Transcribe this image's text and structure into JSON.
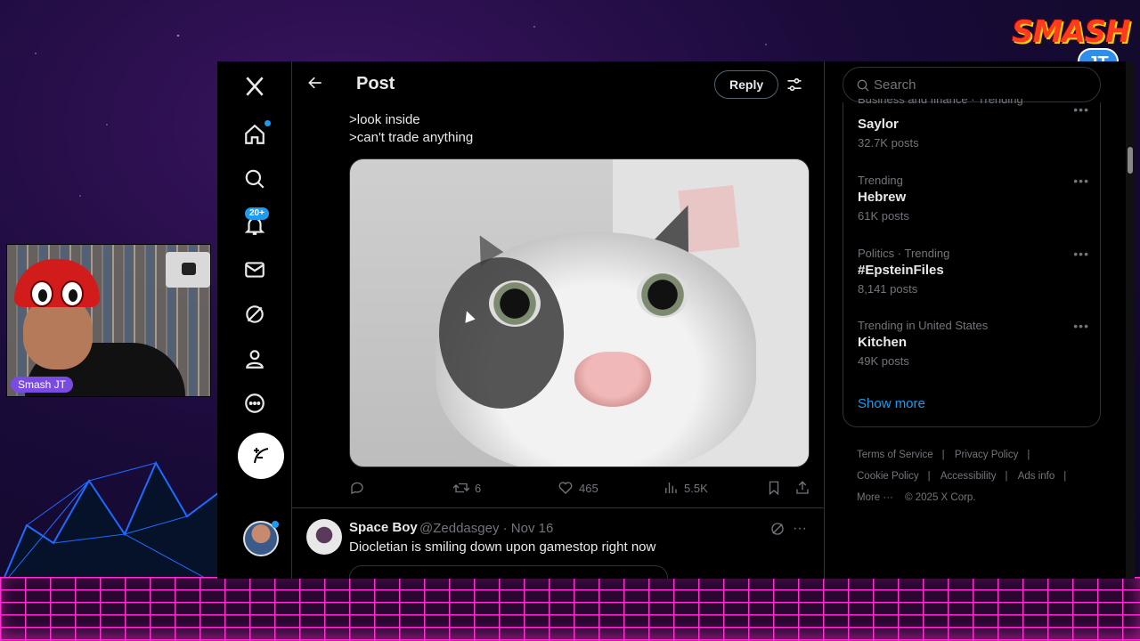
{
  "overlay": {
    "logo_line1": "SMASH",
    "logo_line2": "JT",
    "webcam_name": "Smash JT"
  },
  "nav": {
    "notifications_badge": "20+"
  },
  "header": {
    "title": "Post",
    "reply_label": "Reply"
  },
  "post": {
    "text_lines": [
      ">look inside",
      ">can't trade anything"
    ],
    "stats": {
      "replies": "",
      "reposts": "6",
      "likes": "465",
      "views": "5.5K"
    }
  },
  "reply_tweet": {
    "name": "Space Boy",
    "handle_date": "@Zeddasgey · Nov 16",
    "text": "Diocletian is smiling down upon gamestop right now"
  },
  "sidebar": {
    "search_placeholder": "Search",
    "trends": [
      {
        "category": "Business and finance · Trending",
        "name": "Saylor",
        "count": "32.7K posts"
      },
      {
        "category": "Trending",
        "name": "Hebrew",
        "count": "61K posts"
      },
      {
        "category": "Politics · Trending",
        "name": "#EpsteinFiles",
        "count": "8,141 posts"
      },
      {
        "category": "Trending in United States",
        "name": "Kitchen",
        "count": "49K posts"
      }
    ],
    "show_more": "Show more",
    "footer": {
      "terms": "Terms of Service",
      "privacy": "Privacy Policy",
      "cookie": "Cookie Policy",
      "accessibility": "Accessibility",
      "ads": "Ads info",
      "more": "More ···",
      "copyright": "© 2025 X Corp."
    }
  },
  "colors": {
    "accent": "#1d9bf0",
    "background": "#000000",
    "text": "#e7e9ea",
    "muted": "#71767b"
  }
}
